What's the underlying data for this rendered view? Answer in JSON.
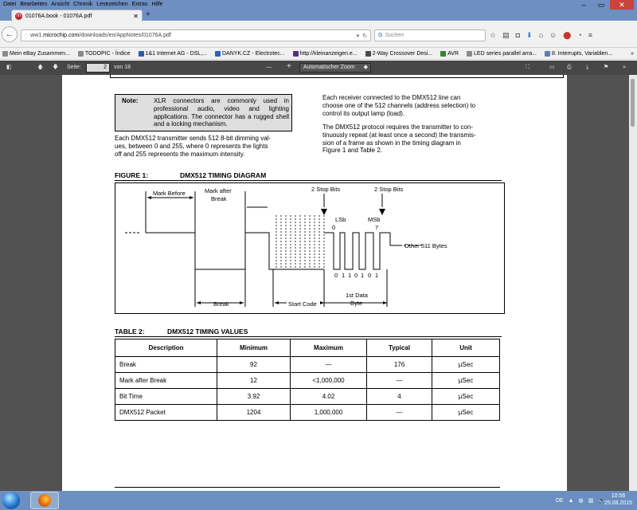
{
  "menu": [
    "Datei",
    "Bearbeiten",
    "Ansicht",
    "Chronik",
    "Lesezeichen",
    "Extras",
    "Hilfe"
  ],
  "tab": {
    "title": "01076A.book - 01076A.pdf"
  },
  "url": {
    "prefix": "ww1.",
    "domain": "microchip.com",
    "path": "/downloads/en/AppNotes/01076A.pdf"
  },
  "search": {
    "placeholder": "Suchen"
  },
  "bookmarks": [
    "Mein eBay Zusammen...",
    "TODOPIC - Índice",
    "1&1 Internet AG - DSL,...",
    "DANYK.CZ - Electrotec...",
    "http://kleinanzeigen.e...",
    "2-Way Crossover Desi...",
    "AVR",
    "LED series parallel arra...",
    "8. Interrupts, Variablen..."
  ],
  "pdf_toolbar": {
    "page_label": "Seite:",
    "page_value": "2",
    "page_total": "von 18",
    "zoom": "Automatischer Zoom",
    "zoom_minus": "—",
    "zoom_plus": "+"
  },
  "document": {
    "note_label": "Note:",
    "note_text": "XLR connectors are commonly used in professional audio, video and lighting applications. The connector has a rugged shell and a locking mechanism.",
    "para_left_lines": [
      "Each DMX512 transmitter sends 512 8-bit dimming val-",
      "ues, between 0 and 255, where 0 represents the lights",
      "off and 255 represents the maximum intensity."
    ],
    "para_right1_lines": [
      "Each receiver connected to the DMX512 line can",
      "choose one of the 512 channels (address selection) to",
      "control its output lamp (load)."
    ],
    "para_right2_lines": [
      "The DMX512 protocol requires the transmitter to con-",
      "tinuously repeat (at least once a second) the transmis-",
      "sion of a frame as shown in the timing diagram in",
      "Figure 1 and Table 2."
    ],
    "figure_label": "FIGURE 1:",
    "figure_title": "DMX512 TIMING DIAGRAM",
    "diagram": {
      "mark_before": "Mark Before",
      "mark_after_1": "Mark after",
      "mark_after_2": "Break",
      "stop_bits_1": "2 Stop Bits",
      "stop_bits_2": "2 Stop Bits",
      "lsb": "LSb",
      "msb": "MSb",
      "other": "Other 511 Bytes",
      "break": "Break",
      "start_code": "Start Code",
      "first_data_1": "1st Data",
      "first_data_2": "Byte",
      "lsb_bit": "0",
      "msb_bit": "7",
      "bits": [
        "0",
        "1",
        "1",
        "0",
        "1",
        "0",
        "1"
      ]
    },
    "table_label": "TABLE 2:",
    "table_title": "DMX512 TIMING VALUES",
    "table": {
      "headers": [
        "Description",
        "Minimum",
        "Maximum",
        "Typical",
        "Unit"
      ],
      "rows": [
        [
          "Break",
          "92",
          "—",
          "176",
          "µSec"
        ],
        [
          "Mark after Break",
          "12",
          "<1,000,000",
          "—",
          "µSec"
        ],
        [
          "Bit Time",
          "3.92",
          "4.02",
          "4",
          "µSec"
        ],
        [
          "DMX512 Packet",
          "1204",
          "1,000,000",
          "—",
          "µSec"
        ]
      ]
    }
  },
  "taskbar": {
    "lang": "DE",
    "time": "10:56",
    "date": "25.08.2015"
  }
}
